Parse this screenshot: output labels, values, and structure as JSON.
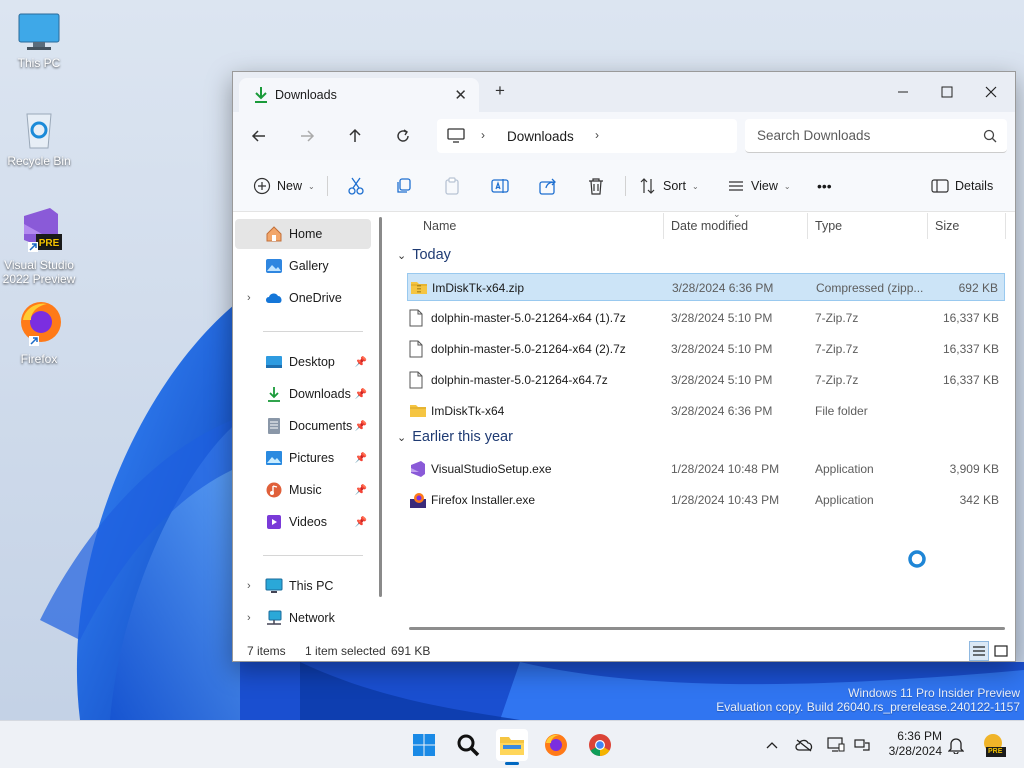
{
  "desktop": {
    "icons": [
      {
        "label": "This PC"
      },
      {
        "label": "Recycle Bin"
      },
      {
        "label": "Visual Studio 2022 Preview",
        "badge": "PRE"
      },
      {
        "label": "Firefox"
      }
    ],
    "watermark_line1": "Windows 11 Pro Insider Preview",
    "watermark_line2": "Evaluation copy. Build 26040.rs_prerelease.240122-1157"
  },
  "window": {
    "tab_title": "Downloads",
    "tab_close_icon": "close-icon",
    "new_tab_symbol": "+",
    "controls": [
      "minimize-icon",
      "maximize-icon",
      "close-icon"
    ],
    "address": {
      "root_icon": "monitor-icon",
      "segment": "Downloads"
    },
    "search_placeholder": "Search Downloads",
    "toolbar": {
      "new_label": "New",
      "sort_label": "Sort",
      "view_label": "View",
      "more_label": "•••",
      "details_label": "Details"
    },
    "nav": {
      "items": [
        {
          "label": "Home",
          "icon": "home-icon",
          "selected": true
        },
        {
          "label": "Gallery",
          "icon": "gallery-icon"
        },
        {
          "label": "OneDrive",
          "icon": "cloud-icon"
        },
        {
          "label": "Desktop",
          "icon": "desktop-icon",
          "pinned": true
        },
        {
          "label": "Downloads",
          "icon": "download-icon",
          "pinned": true
        },
        {
          "label": "Documents",
          "icon": "document-icon",
          "pinned": true
        },
        {
          "label": "Pictures",
          "icon": "pictures-icon",
          "pinned": true
        },
        {
          "label": "Music",
          "icon": "music-icon",
          "pinned": true
        },
        {
          "label": "Videos",
          "icon": "videos-icon",
          "pinned": true
        },
        {
          "label": "This PC",
          "icon": "monitor-icon"
        },
        {
          "label": "Network",
          "icon": "network-icon"
        }
      ]
    },
    "columns": {
      "name": "Name",
      "date": "Date modified",
      "type": "Type",
      "size": "Size"
    },
    "groups": [
      {
        "title": "Today",
        "files": [
          {
            "name": "ImDiskTk-x64.zip",
            "date": "3/28/2024 6:36 PM",
            "type": "Compressed (zipp...",
            "size": "692 KB",
            "icon": "zip-folder-icon",
            "selected": true
          },
          {
            "name": "dolphin-master-5.0-21264-x64 (1).7z",
            "date": "3/28/2024 5:10 PM",
            "type": "7-Zip.7z",
            "size": "16,337 KB",
            "icon": "file-icon"
          },
          {
            "name": "dolphin-master-5.0-21264-x64 (2).7z",
            "date": "3/28/2024 5:10 PM",
            "type": "7-Zip.7z",
            "size": "16,337 KB",
            "icon": "file-icon"
          },
          {
            "name": "dolphin-master-5.0-21264-x64.7z",
            "date": "3/28/2024 5:10 PM",
            "type": "7-Zip.7z",
            "size": "16,337 KB",
            "icon": "file-icon"
          },
          {
            "name": "ImDiskTk-x64",
            "date": "3/28/2024 6:36 PM",
            "type": "File folder",
            "size": "",
            "icon": "folder-icon"
          }
        ]
      },
      {
        "title": "Earlier this year",
        "files": [
          {
            "name": "VisualStudioSetup.exe",
            "date": "1/28/2024 10:48 PM",
            "type": "Application",
            "size": "3,909 KB",
            "icon": "visual-studio-icon"
          },
          {
            "name": "Firefox Installer.exe",
            "date": "1/28/2024 10:43 PM",
            "type": "Application",
            "size": "342 KB",
            "icon": "installer-icon"
          }
        ]
      }
    ],
    "status": {
      "count": "7 items",
      "selection": "1 item selected",
      "selection_size": "691 KB"
    }
  },
  "taskbar": {
    "apps": [
      "start-icon",
      "search-icon",
      "file-explorer-icon",
      "firefox-icon",
      "chrome-icon"
    ],
    "tray": [
      "chevron-up-icon",
      "onedrive-offline-icon",
      "display-icon",
      "network-icon",
      "volume-icon"
    ],
    "time": "6:36 PM",
    "date": "3/28/2024",
    "badge": "PRE"
  },
  "colors": {
    "accent": "#0067c0",
    "selection": "#cce4f7",
    "wallpaper": "#1f66d6"
  }
}
